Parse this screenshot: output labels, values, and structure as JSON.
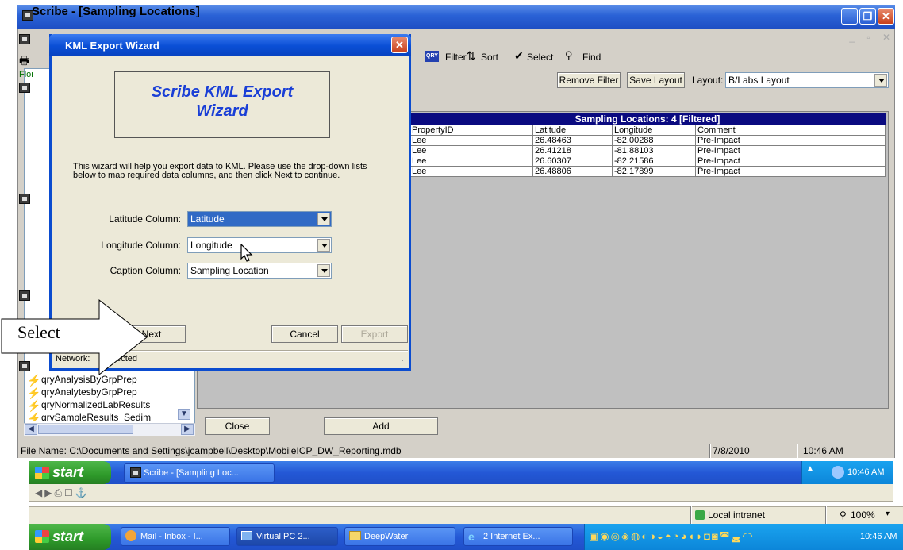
{
  "outer_window": {
    "title": "Scribe - [Sampling Locations]"
  },
  "toolbar": {
    "filter_icon": "QRY",
    "filter_label": "Filter",
    "sort_label": "Sort",
    "select_label": "Select",
    "find_label": "Find",
    "remove_filter_label": "Remove Filter",
    "save_layout_label": "Save Layout",
    "layout_label": "Layout:",
    "layout_value": "B/Labs Layout"
  },
  "left_panel": {
    "cut_label": "Flor",
    "items": [
      "qryAnalysisByGrpPrep",
      "qryAnalytesbyGrpPrep",
      "qryNormalizedLabResults",
      "qrySampleResults_Sedim"
    ]
  },
  "grid": {
    "caption": "Sampling Locations: 4 [Filtered]",
    "columns": [
      "PropertyID",
      "Latitude",
      "Longitude",
      "Comment"
    ],
    "rows": [
      [
        "Lee",
        "26.48463",
        "-82.00288",
        "Pre-Impact"
      ],
      [
        "Lee",
        "26.41218",
        "-81.88103",
        "Pre-Impact"
      ],
      [
        "Lee",
        "26.60307",
        "-82.21586",
        "Pre-Impact"
      ],
      [
        "Lee",
        "26.48806",
        "-82.17899",
        "Pre-Impact"
      ]
    ]
  },
  "footer_buttons": {
    "close_label": "Close",
    "add_label": "Add"
  },
  "status": {
    "file_name": "File Name: C:\\Documents and Settings\\jcampbell\\Desktop\\MobileICP_DW_Reporting.mdb",
    "date": "7/8/2010",
    "time": "10:46 AM"
  },
  "wizard": {
    "title": "KML Export Wizard",
    "banner_line1": "Scribe KML Export",
    "banner_line2": "Wizard",
    "description": "This wizard will help you export data to KML.  Please use the drop-down lists below to map required data columns, and then click Next to continue.",
    "latitude_label": "Latitude Column:",
    "latitude_value": "Latitude",
    "longitude_label": "Longitude Column:",
    "longitude_value": "Longitude",
    "caption_label": "Caption Column:",
    "caption_value": "Sampling Location",
    "next_label": "Next",
    "cancel_label": "Cancel",
    "export_label": "Export",
    "status_label": "Network:",
    "status_value": "nected"
  },
  "callout": {
    "text": "Select"
  },
  "taskbar_inner": {
    "start_label": "start",
    "task_label": "Scribe - [Sampling Loc...",
    "clock": "10:46 AM"
  },
  "ie_status": {
    "zone": "Local intranet",
    "zoom": "100%"
  },
  "taskbar_outer": {
    "start_label": "start",
    "tasks": [
      "Mail - Inbox - I...",
      "Virtual PC 2...",
      "DeepWater",
      "2 Internet Ex..."
    ],
    "clock": "10:46 AM"
  },
  "colors": {
    "xp_blue": "#2458d6",
    "grid_caption": "#0a0a80",
    "wizard_banner_text": "#1a3fd6",
    "start_green": "#2e9a2a"
  }
}
